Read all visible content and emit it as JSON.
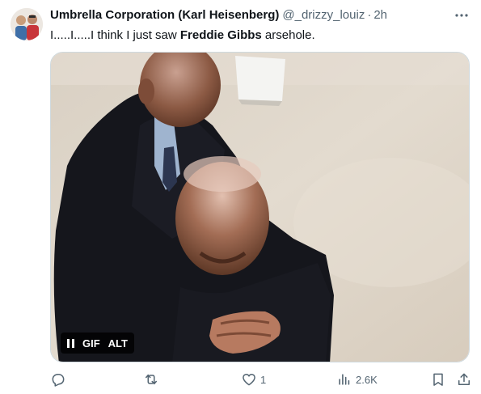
{
  "tweet": {
    "author_name": "Umbrella Corporation (Karl Heisenberg)",
    "handle": "@_drizzy_louiz",
    "separator": "·",
    "time": "2h",
    "text_before": "I.....I.....I think I just saw ",
    "text_bold": "Freddie Gibbs",
    "text_after": " arsehole."
  },
  "media": {
    "gif_label": "GIF",
    "alt_label": "ALT"
  },
  "actions": {
    "reply_count": "",
    "retweet_count": "",
    "like_count": "1",
    "views_count": "2.6K"
  },
  "colors": {
    "text": "#0f1419",
    "muted": "#536471",
    "border": "#cfd9de"
  }
}
